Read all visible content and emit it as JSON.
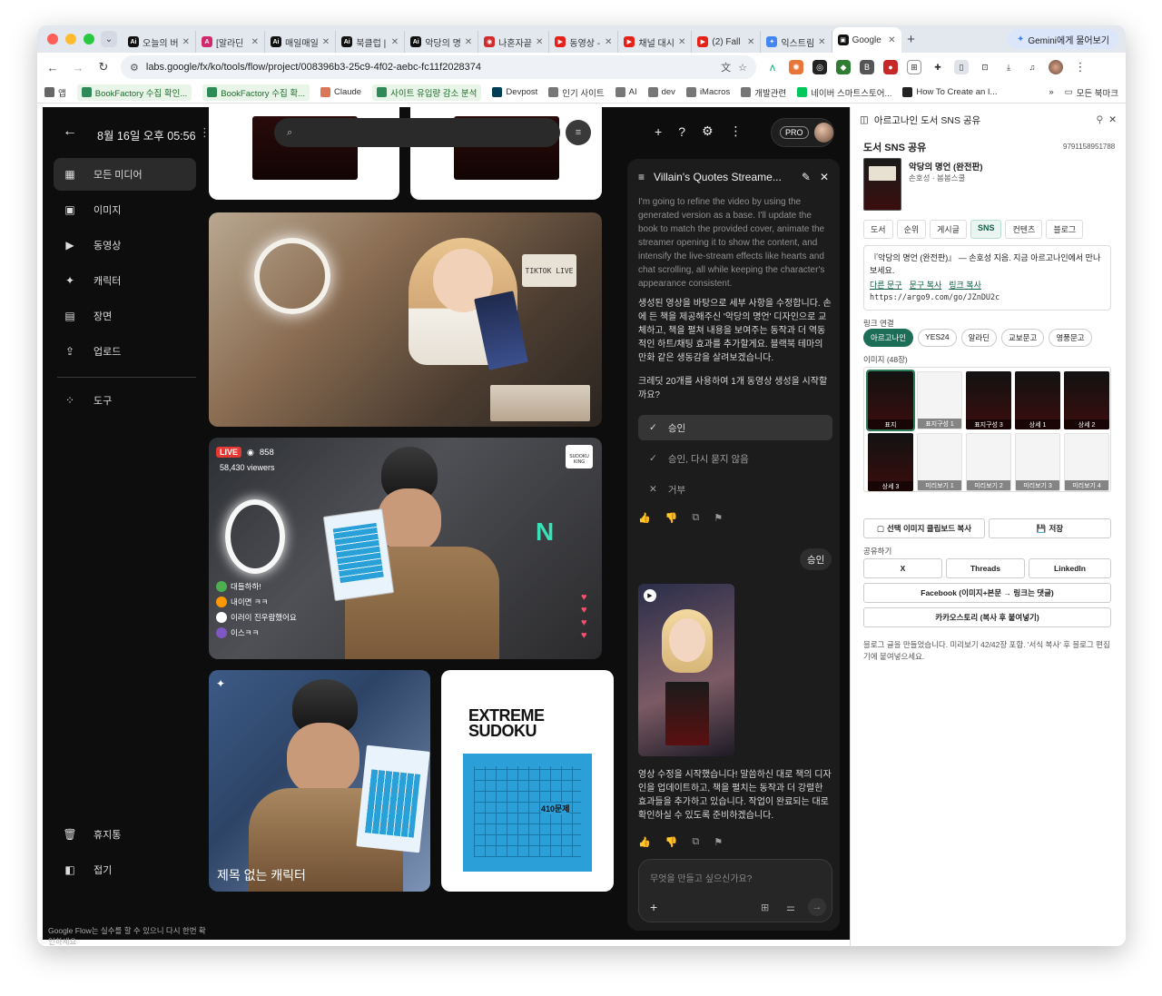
{
  "browser": {
    "tabs": [
      {
        "label": "오늘의 버",
        "fav_color": "#111111",
        "fav_text": "Ai"
      },
      {
        "label": "[알라딘",
        "fav_color": "#d2286e",
        "fav_text": "A"
      },
      {
        "label": "매일매일",
        "fav_color": "#111111",
        "fav_text": "Ai"
      },
      {
        "label": "북클럽 |",
        "fav_color": "#111111",
        "fav_text": "Ai"
      },
      {
        "label": "악당의 명",
        "fav_color": "#111111",
        "fav_text": "Ai"
      },
      {
        "label": "나혼자끝",
        "fav_color": "#d22b2b",
        "fav_text": "◉"
      },
      {
        "label": "동영상 -",
        "fav_color": "#e62117",
        "fav_text": "▶"
      },
      {
        "label": "채널 대시",
        "fav_color": "#e62117",
        "fav_text": "▶"
      },
      {
        "label": "(2) Fall",
        "fav_color": "#e62117",
        "fav_text": "▶"
      },
      {
        "label": "익스트림",
        "fav_color": "#4285f4",
        "fav_text": "✦"
      },
      {
        "label": "Google",
        "fav_color": "#111111",
        "fav_text": "▣",
        "active": true
      }
    ],
    "gemini_button": "Gemini에게 물어보기",
    "url": "labs.google/fx/ko/tools/flow/project/008396b3-25c9-4f02-aebc-fc11f2028374",
    "bookmarks": [
      {
        "label": "앱",
        "color": "#666666"
      },
      {
        "label": "BookFactory 수집 확인...",
        "color": "#2e8b57",
        "pill": true
      },
      {
        "label": "BookFactory 수집 확...",
        "color": "#2e8b57",
        "pill": true
      },
      {
        "label": "Claude",
        "color": "#d97757"
      },
      {
        "label": "사이트 유입량 감소 분석",
        "color": "#2e8b57",
        "pill": true
      },
      {
        "label": "Devpost",
        "color": "#003e54"
      },
      {
        "label": "인기 사이트",
        "color": "#777777"
      },
      {
        "label": "AI",
        "color": "#777777"
      },
      {
        "label": "dev",
        "color": "#777777"
      },
      {
        "label": "iMacros",
        "color": "#777777"
      },
      {
        "label": "개발관련",
        "color": "#777777"
      },
      {
        "label": "네이버 스마트스토어...",
        "color": "#03c75a"
      },
      {
        "label": "How To Create an I...",
        "color": "#222222"
      }
    ],
    "all_bookmarks": "모든 북마크"
  },
  "flow": {
    "date": "8월 16일 오후 05:56",
    "nav": [
      {
        "label": "모든 미디어",
        "icon": "▦",
        "selected": true
      },
      {
        "label": "이미지",
        "icon": "▣"
      },
      {
        "label": "동영상",
        "icon": "▶"
      },
      {
        "label": "캐릭터",
        "icon": "✦"
      },
      {
        "label": "장면",
        "icon": "▤"
      },
      {
        "label": "업로드",
        "icon": "⇪"
      }
    ],
    "tools": "도구",
    "trash": "휴지통",
    "collapse": "접기",
    "disclaimer": "Google Flow는 실수를 할 수 있으니 다시 한번 확인하세요",
    "pro_badge": "PRO",
    "gallery": {
      "live_label": "LIVE",
      "live_count": "858",
      "viewers": "58,430 viewers",
      "sudoku_king": "SUDOKU KING",
      "chat_lines": [
        "대들하하!",
        "내이면 ㅋㅋ",
        "이러이 진우람했어요",
        "이스ㅋㅋ"
      ],
      "character_caption": "제목 없는 캐릭터",
      "sudoku_cover_title": "EXTREME SUDOKU",
      "sudoku_cover_count": "410문제",
      "tiktok_sign": "TIKTOK LIVE"
    }
  },
  "chat": {
    "title": "Villain's Quotes Streame...",
    "intro_en": "I'm going to refine the video by using the generated version as a base. I'll update the book to match the provided cover, animate the streamer opening it to show the content, and intensify the live-stream effects like hearts and chat scrolling, all while keeping the character's appearance consistent.",
    "intro_ko": "생성된 영상을 바탕으로 세부 사항을 수정합니다. 손에 든 책을 제공해주신 '악당의 명언' 디자인으로 교체하고, 책을 펼쳐 내용을 보여주는 동작과 더 역동적인 하트/채팅 효과를 추가할게요. 블랙북 테마의 만화 같은 생동감을 살려보겠습니다.",
    "question": "크레딧 20개를 사용하여 1개 동영상 생성을 시작할까요?",
    "options": [
      "승인",
      "승인, 다시 묻지 않음",
      "거부"
    ],
    "user_reply": "승인",
    "response": "영상 수정을 시작했습니다! 말씀하신 대로 책의 디자인을 업데이트하고, 책을 펼치는 동작과 더 강렬한 효과들을 추가하고 있습니다. 작업이 완료되는 대로 확인하실 수 있도록 준비하겠습니다.",
    "input_placeholder": "무엇을 만들고 싶으신가요?"
  },
  "extension": {
    "title": "아르고나인 도서 SNS 공유",
    "section_title": "도서 SNS 공유",
    "isbn": "9791158951788",
    "book_name": "악당의 명언 (완전판)",
    "book_author": "손호성 · 봄봄스쿨",
    "tabs": [
      "도서",
      "순위",
      "게시글",
      "SNS",
      "컨텐츠",
      "블로그"
    ],
    "active_tab": "SNS",
    "sns_text": "『악당의 명언 (완전판)』 — 손호성 지음. 지금 아르고나인에서 만나보세요.",
    "copy_links": [
      "다른 문구",
      "문구 복사",
      "링크 복사"
    ],
    "short_url": "https://argo9.com/go/JZnDU2c",
    "link_label": "링크 연결",
    "link_chips": [
      "아르고나인",
      "YES24",
      "알라딘",
      "교보문고",
      "영풍문고"
    ],
    "images_label": "이미지 (48장)",
    "thumbs": [
      {
        "cap": "표지",
        "style": "dark"
      },
      {
        "cap": "표지구성 1",
        "style": "light"
      },
      {
        "cap": "표지구성 3",
        "style": "dark"
      },
      {
        "cap": "상세 1",
        "style": "dark"
      },
      {
        "cap": "상세 2",
        "style": "dark"
      },
      {
        "cap": "상세 3",
        "style": "dark"
      },
      {
        "cap": "미리보기 1",
        "style": "light"
      },
      {
        "cap": "미리보기 2",
        "style": "light"
      },
      {
        "cap": "미리보기 3",
        "style": "light"
      },
      {
        "cap": "미리보기 4",
        "style": "light"
      }
    ],
    "copy_clipboard": "선택 이미지 클립보드 복사",
    "save": "저장",
    "share_label": "공유하기",
    "share_buttons": [
      "X",
      "Threads",
      "LinkedIn"
    ],
    "facebook_button": "Facebook (이미지+본문 → 링크는 댓글)",
    "kakao_button": "카카오스토리 (복사 후 붙여넣기)",
    "note": "블로그 글을 만들었습니다. 미리보기 42/42장 포함. '서식 복사' 후 블로그 편집기에 붙여넣으세요."
  }
}
